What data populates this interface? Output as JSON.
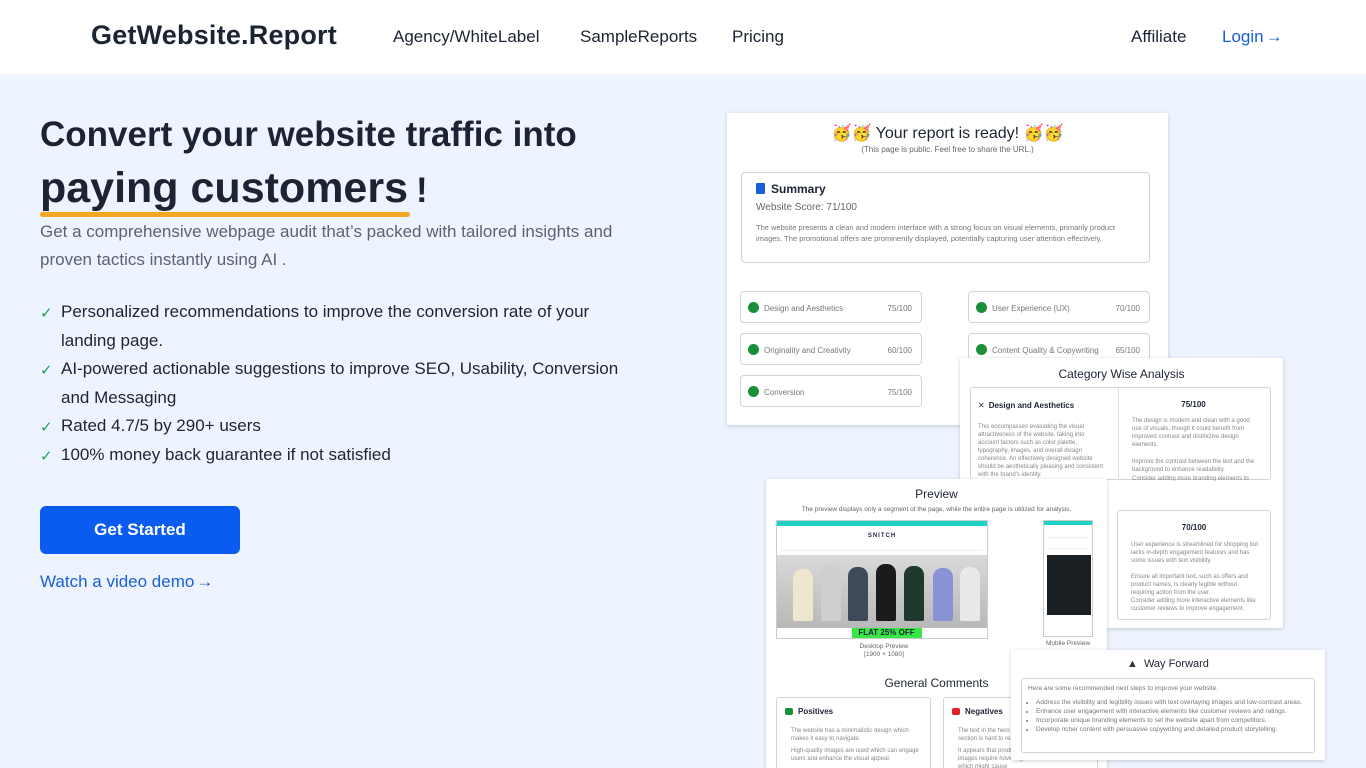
{
  "nav": {
    "brand": "GetWebsite.Report",
    "links": [
      "Agency/WhiteLabel",
      "SampleReports",
      "Pricing"
    ],
    "affiliate": "Affiliate",
    "login": "Login",
    "login_icon": "arrow-right-icon"
  },
  "hero": {
    "headline_line1": "Convert your website traffic into",
    "headline_highlight": "paying customers",
    "headline_end": "!",
    "subtitle": "Get a comprehensive webpage audit that’s packed with tailored insights and proven tactics instantly using AI .",
    "features": [
      "Personalized recommendations to improve the conversion rate of your landing page.",
      "AI-powered actionable suggestions to improve SEO, Usability, Conversion and Messaging",
      "Rated 4.7/5 by 290+ users",
      "100% money back guarantee if not satisfied"
    ],
    "check_icon": "check-icon",
    "cta": "Get Started",
    "video_link": "Watch a video demo",
    "accent_color": "#0a5cf0",
    "highlight_color": "#f5a623"
  },
  "report": {
    "title": "🥳🥳 Your report is ready! 🥳🥳",
    "note": "(This page is public. Feel free to share the URL.)",
    "summary": {
      "title": "Summary",
      "score": "Website Score: 71/100",
      "description": "The website presents a clean and modern interface with a strong focus on visual elements, primarily product images. The promotional offers are prominently displayed, potentially capturing user attention effectively."
    },
    "scores": [
      {
        "name": "Design and Aesthetics",
        "value": "75/100"
      },
      {
        "name": "User Experience (UX)",
        "value": "70/100"
      },
      {
        "name": "Originality and Creativity",
        "value": "60/100"
      },
      {
        "name": "Content Quality & Copywriting",
        "value": "65/100"
      },
      {
        "name": "Conversion",
        "value": "75/100"
      }
    ]
  },
  "category": {
    "title": "Category Wise Analysis",
    "item_title": "Design and Aesthetics",
    "item_text": "This encompasses evaluating the visual attractiveness of the website, taking into account factors such as color palette, typography, images, and overall design coherence. An effectively designed website should be aesthetically pleasing and consistent with the brand's identity.",
    "score1": "75/100",
    "text1": "The design is modern and clean with a good use of visuals, though it could benefit from improved contrast and distinctive design elements.",
    "bullets1": [
      "Improve the contrast between the text and the background to enhance readability.",
      "Consider adding more branding elements to create a unique and memorable identity."
    ],
    "score2": "70/100",
    "text2": "User experience is streamlined for shopping but lacks in-depth engagement features and has some issues with text visibility.",
    "bullets2": [
      "Ensure all important text, such as offers and product names, is clearly legible without requiring action from the user.",
      "Consider adding more interactive elements like customer reviews to improve engagement."
    ]
  },
  "preview": {
    "title": "Preview",
    "note": "The preview displays only a segment of the page, while the entire page is utilized for analysis.",
    "site_logo": "SNITCH",
    "offer": "FLAT 25% OFF",
    "desktop_caption": "Desktop Preview",
    "desktop_size": "[1900 × 1080]",
    "mobile_caption": "Mobile Preview",
    "comments_title": "General Comments",
    "positives_title": "Positives",
    "positives": [
      "The website has a minimalistic design which makes it easy to navigate.",
      "High-quality images are used which can engage users and enhance the visual appeal."
    ],
    "negatives_title": "Negatives",
    "negatives": [
      "The text in the hero section is hard to read on the product image, which",
      "It appears that product images require hovering, which might cause frustration for users seeking quick information."
    ]
  },
  "way_forward": {
    "title": "Way Forward",
    "intro": "Here are some recommended next steps to improve your website.",
    "items": [
      "Address the visibility and legibility issues with text overlaying images and low-contrast areas.",
      "Enhance user engagement with interactive elements like customer reviews and ratings.",
      "Incorporate unique branding elements to set the website apart from competitors.",
      "Develop richer content with persuasive copywriting and detailed product storytelling."
    ]
  }
}
